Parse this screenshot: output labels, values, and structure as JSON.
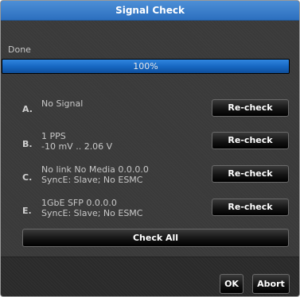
{
  "dialog": {
    "title": "Signal Check"
  },
  "progress": {
    "label": "Done",
    "percent_text": "100%",
    "fraction": 1.0
  },
  "rows": [
    {
      "letter": "A.",
      "line1": "No Signal",
      "line2": "",
      "button": "Re-check"
    },
    {
      "letter": "B.",
      "line1": "1 PPS",
      "line2": "-10 mV .. 2.06 V",
      "button": "Re-check"
    },
    {
      "letter": "C.",
      "line1": "No link No Media  0.0.0.0",
      "line2": "SyncE: Slave; No ESMC",
      "button": "Re-check"
    },
    {
      "letter": "E.",
      "line1": "1GbE SFP  0.0.0.0",
      "line2": "SyncE: Slave; No ESMC",
      "button": "Re-check"
    }
  ],
  "check_all": {
    "label": "Check All"
  },
  "footer": {
    "ok_label": "OK",
    "abort_label": "Abort"
  }
}
